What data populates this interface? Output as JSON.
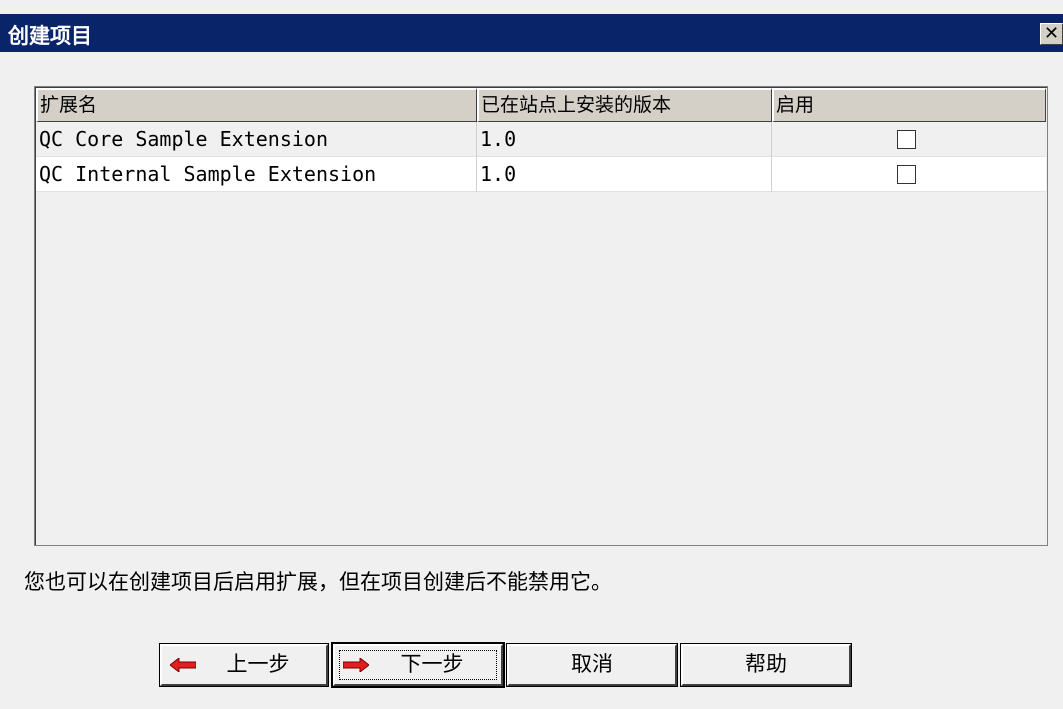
{
  "window": {
    "title": "创建项目",
    "close_glyph": "✕"
  },
  "table": {
    "columns": [
      "扩展名",
      "已在站点上安装的版本",
      "启用"
    ],
    "rows": [
      {
        "name": "QC Core Sample Extension",
        "version": "1.0",
        "enabled": false
      },
      {
        "name": "QC Internal Sample Extension",
        "version": "1.0",
        "enabled": false
      }
    ]
  },
  "note": "您也可以在创建项目后启用扩展，但在项目创建后不能禁用它。",
  "buttons": {
    "back": {
      "label": "上一步",
      "icon": "arrow-left-icon"
    },
    "next": {
      "label": "下一步",
      "icon": "arrow-right-icon"
    },
    "cancel": {
      "label": "取消"
    },
    "help": {
      "label": "帮助"
    }
  },
  "colors": {
    "titlebar": "#0a246a",
    "arrow": "#e02020"
  }
}
